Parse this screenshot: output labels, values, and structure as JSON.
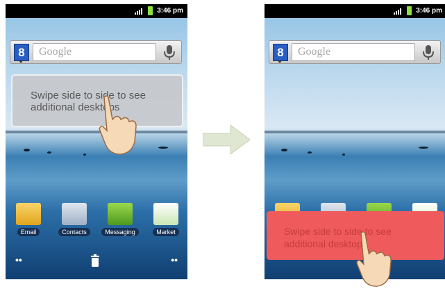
{
  "status": {
    "time": "3:46 pm"
  },
  "search": {
    "logo": "8",
    "placeholder": "Google"
  },
  "tip": {
    "text_line1": "Swipe side to side to see",
    "text_line2": "additional desktops"
  },
  "apps": [
    {
      "label": "Email",
      "icon": "email-icon"
    },
    {
      "label": "Contacts",
      "icon": "contacts-icon"
    },
    {
      "label": "Messaging",
      "icon": "messaging-icon"
    },
    {
      "label": "Market",
      "icon": "market-icon"
    }
  ],
  "navbar": {
    "left_dots": "••",
    "right_dots": "••"
  },
  "colors": {
    "tip_default": "#c6c8cc",
    "tip_pressed": "#ef5a5c",
    "arrow": "#dfe7d3"
  }
}
